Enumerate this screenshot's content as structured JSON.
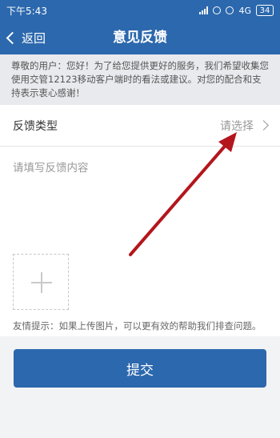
{
  "statusbar": {
    "time": "下午5:43",
    "network": "4G",
    "battery": "34"
  },
  "navbar": {
    "back_label": "返回",
    "title": "意见反馈"
  },
  "notice": {
    "text": "尊敬的用户：您好！为了给您提供更好的服务，我们希望收集您使用交管12123移动客户端时的看法或建议。对您的配合和支持表示衷心感谢！"
  },
  "form": {
    "type_label": "反馈类型",
    "type_value": "请选择",
    "content_placeholder": "请填写反馈内容",
    "tip": "友情提示：如果上传图片，可以更有效的帮助我们排查问题。"
  },
  "submit_label": "提交",
  "colors": {
    "primary": "#2c68ad",
    "annotation_arrow": "#b3161c"
  }
}
